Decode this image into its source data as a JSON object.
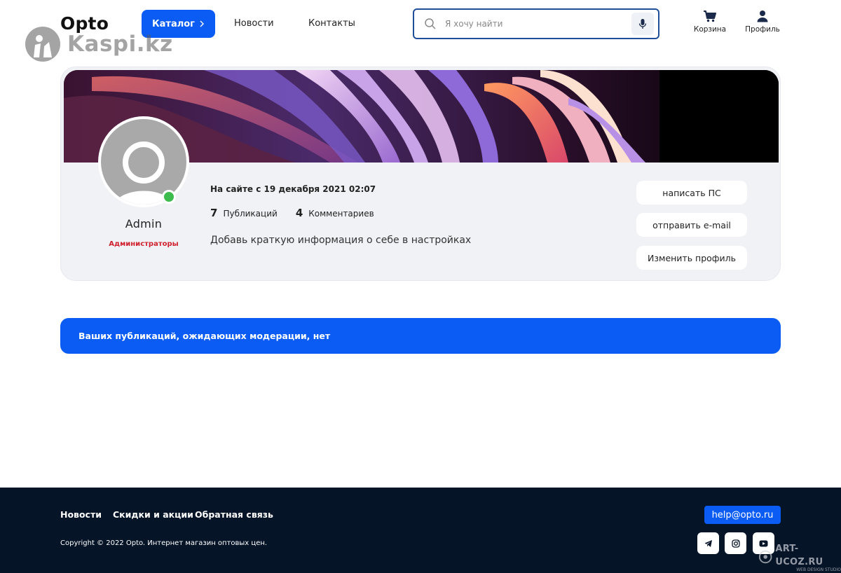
{
  "header": {
    "logo": "Opto",
    "catalog_label": "Каталог",
    "nav": [
      "Новости",
      "Контакты"
    ],
    "search_placeholder": "Я хочу найти",
    "cart_label": "Корзина",
    "profile_label": "Профиль"
  },
  "watermark": {
    "text": "Kaspi.kz"
  },
  "profile": {
    "name": "Admin",
    "group": "Администраторы",
    "since": "На сайте с 19 декабря 2021 02:07",
    "publications_count": "7",
    "publications_label": "Публикаций",
    "comments_count": "4",
    "comments_label": "Комментариев",
    "about": "Добавь краткую информация о себе в настройках",
    "online": true,
    "buttons": [
      "написать ПС",
      "отправить e-mail",
      "Изменить профиль"
    ]
  },
  "moderation_notice": "Ваших публикаций, ожидающих модерации, нет",
  "footer": {
    "links": [
      "Новости",
      "Скидки и акции",
      "Обратная связь"
    ],
    "email": "help@opto.ru",
    "copyright": "Copyright © 2022 Opto. Интернет магазин оптовых цен.",
    "socials": [
      "telegram-icon",
      "instagram-icon",
      "youtube-icon"
    ],
    "studio_name": "ART-UCOZ.RU",
    "studio_tagline": "WEB DESIGN STUDIO"
  },
  "colors": {
    "accent": "#0a5cf5",
    "footer_bg": "#061428",
    "online": "#3dbb4d",
    "group": "#d0202e"
  }
}
